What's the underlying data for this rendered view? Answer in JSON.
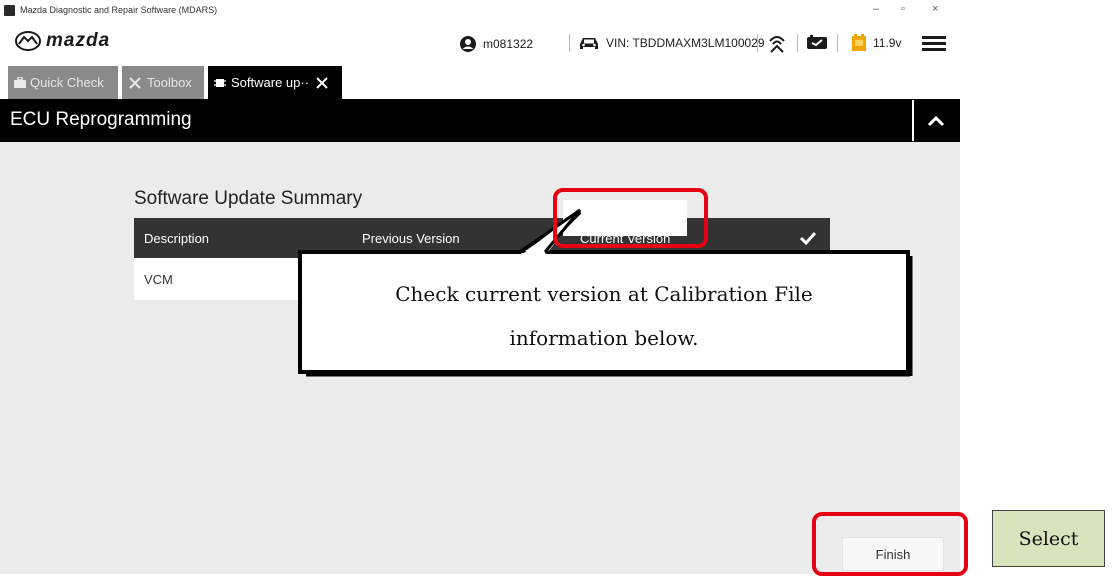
{
  "window": {
    "title": "Mazda Diagnostic and Repair Software (MDARS)",
    "minimize": "–",
    "maximize": "▫",
    "close": "×"
  },
  "header": {
    "logo_text": "mazda",
    "user_id": "m081322",
    "vin": "VIN: TBDDMAXM3LM100029",
    "voltage": "11.9v"
  },
  "tabs": [
    {
      "label": "Quick Check",
      "active": false
    },
    {
      "label": "Toolbox",
      "active": false
    },
    {
      "label": "Software up··",
      "active": true
    }
  ],
  "section": {
    "title": "ECU Reprogramming"
  },
  "summary": {
    "title": "Software Update Summary",
    "columns": [
      "Description",
      "Previous Version",
      "Current Version"
    ],
    "rows": [
      {
        "description": "VCM"
      }
    ]
  },
  "finish_label": "Finish",
  "annotation": {
    "callout_line1": "Check current version at Calibration File",
    "callout_line2": "information below.",
    "select_label": "Select",
    "highlight_color": "#e60012",
    "select_bg": "#d7e4bc"
  }
}
